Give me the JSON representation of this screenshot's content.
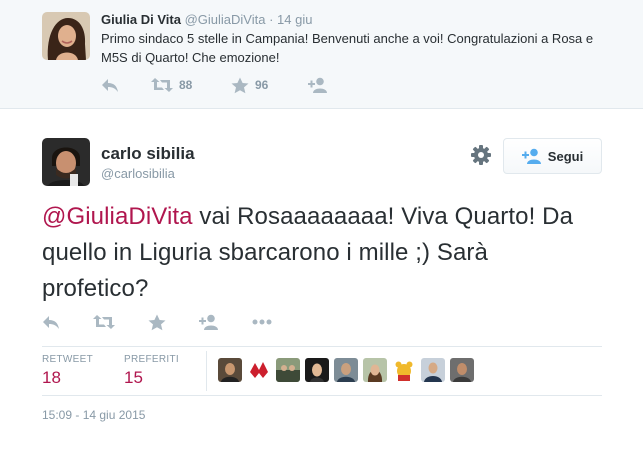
{
  "parent_tweet": {
    "name": "Giulia Di Vita",
    "handle": "@GiuliaDiVita",
    "time": "· 14 giu",
    "text": "Primo sindaco 5 stelle in Campania! Benvenuti anche a voi! Congratulazioni a Rosa e M5S di Quarto! Che emozione!",
    "retweets": "88",
    "favorites": "96"
  },
  "main_tweet": {
    "name": "carlo sibilia",
    "handle": "@carlosibilia",
    "follow_label": "Segui",
    "mention": "@GiuliaDiVita",
    "text": " vai Rosaaaaaaaa! Viva Quarto! Da quello in Liguria sbarcarono i mille ;) Sarà profetico?",
    "timestamp": "15:09 - 14 giu 2015"
  },
  "stats": {
    "retweet_label": "RETWEET",
    "retweet_count": "18",
    "favorites_label": "PREFERITI",
    "favorites_count": "15"
  },
  "icons": {
    "reply": "reply-icon",
    "retweet": "retweet-icon",
    "favorite": "star-icon",
    "follow": "follow-icon",
    "more": "more-icon",
    "settings": "gear-icon"
  },
  "colors": {
    "accent": "#b0164e",
    "muted": "#8899a6",
    "icon": "#aab8c2",
    "text": "#292f33",
    "parent_bg": "#f5f8fa",
    "follow_icon": "#55acee"
  }
}
